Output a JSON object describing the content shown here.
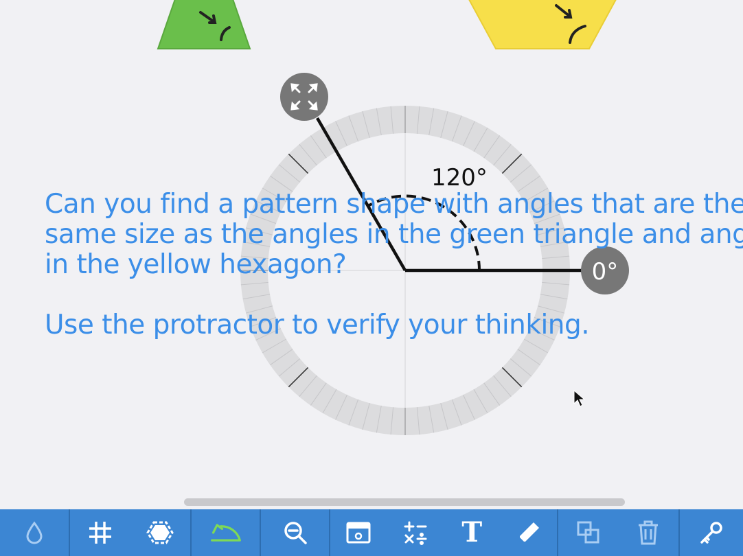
{
  "canvas": {
    "angle_label": "120°",
    "zero_label": "0°",
    "colors": {
      "green_triangle": "#6abf4b",
      "yellow_hexagon": "#f7df4a",
      "protractor_ring": "#dcdcde",
      "handle": "#777777",
      "text": "#3b8ee8"
    }
  },
  "prompt": {
    "line1": "Can you find a pattern shape with angles that are the",
    "line2": "same size as the angles in the green triangle and angle",
    "line3": "in the yellow hexagon?",
    "line4": "Use the protractor to verify your thinking."
  },
  "toolbar": {
    "background": "#3c86d3",
    "active_color": "#7ed957",
    "tools": [
      {
        "name": "color",
        "icon": "droplet-icon"
      },
      {
        "name": "grid",
        "icon": "grid-icon"
      },
      {
        "name": "shapes",
        "icon": "hexagon-icon"
      },
      {
        "name": "protractor",
        "icon": "protractor-icon",
        "active": true
      },
      {
        "name": "zoom",
        "icon": "zoom-out-icon"
      },
      {
        "name": "window",
        "icon": "window-icon"
      },
      {
        "name": "operations",
        "icon": "math-symbols-icon"
      },
      {
        "name": "text",
        "icon": "text-icon",
        "glyph": "T"
      },
      {
        "name": "draw",
        "icon": "pencil-icon"
      },
      {
        "name": "duplicate",
        "icon": "duplicate-icon"
      },
      {
        "name": "delete",
        "icon": "trash-icon"
      },
      {
        "name": "key",
        "icon": "key-icon"
      }
    ]
  }
}
